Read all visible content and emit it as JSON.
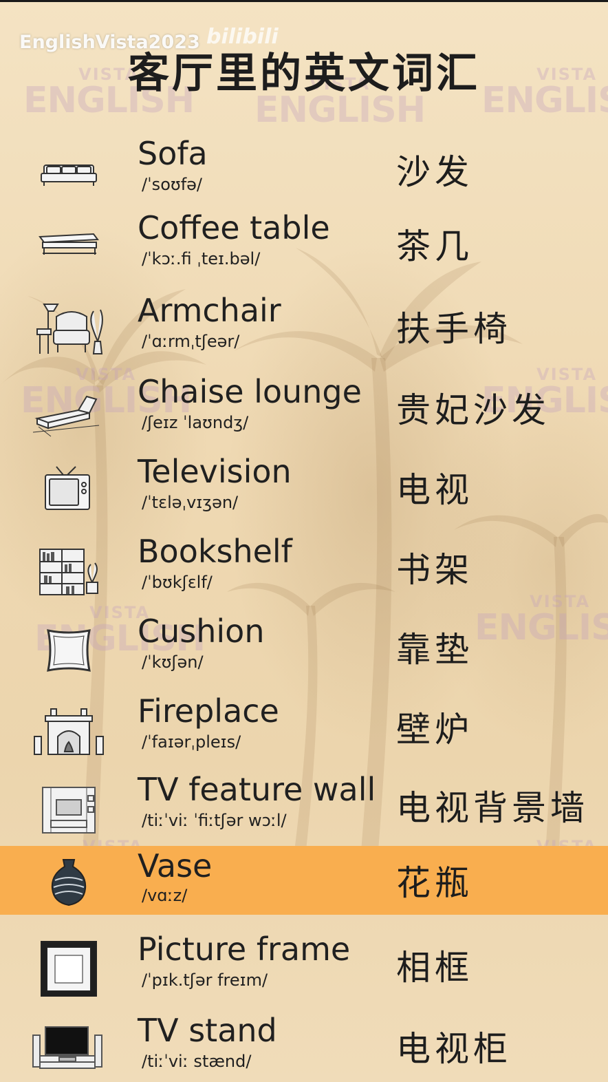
{
  "header": {
    "channel": "EnglishVista2023",
    "platform_logo": "bilibili",
    "title": "客厅里的英文词汇"
  },
  "watermark": {
    "small": "VISTA",
    "big": "ENGLISH"
  },
  "colors": {
    "highlight": "#f9ae4f",
    "background": "#f1dfbd",
    "text": "#1d1d1d"
  },
  "highlighted_index": 9,
  "vocab": [
    {
      "icon": "sofa-icon",
      "word": "Sofa",
      "ipa": "/ˈsoʊfə/",
      "zh": "沙发"
    },
    {
      "icon": "coffee-table-icon",
      "word": "Coffee table",
      "ipa": "/ˈkɔː.fi ˌteɪ.bəl/",
      "zh": "茶几"
    },
    {
      "icon": "armchair-icon",
      "word": "Armchair",
      "ipa": "/ˈɑːrmˌtʃeər/",
      "zh": "扶手椅"
    },
    {
      "icon": "chaise-lounge-icon",
      "word": "Chaise lounge",
      "ipa": "/ʃeɪz ˈlaʊndʒ/",
      "zh": "贵妃沙发"
    },
    {
      "icon": "television-icon",
      "word": "Television",
      "ipa": "/ˈtɛləˌvɪʒən/",
      "zh": "电视"
    },
    {
      "icon": "bookshelf-icon",
      "word": "Bookshelf",
      "ipa": "/ˈbʊkʃɛlf/",
      "zh": "书架"
    },
    {
      "icon": "cushion-icon",
      "word": "Cushion",
      "ipa": "/ˈkʊʃən/",
      "zh": "靠垫"
    },
    {
      "icon": "fireplace-icon",
      "word": "Fireplace",
      "ipa": "/ˈfaɪərˌpleɪs/",
      "zh": "壁炉"
    },
    {
      "icon": "tv-feature-wall-icon",
      "word": "TV feature wall",
      "ipa": "/tiːˈviː ˈfiːtʃər wɔːl/",
      "zh": "电视背景墙"
    },
    {
      "icon": "vase-icon",
      "word": "Vase",
      "ipa": "/vɑːz/",
      "zh": "花瓶"
    },
    {
      "icon": "picture-frame-icon",
      "word": "Picture frame",
      "ipa": "/ˈpɪk.tʃər freɪm/",
      "zh": "相框"
    },
    {
      "icon": "tv-stand-icon",
      "word": "TV stand",
      "ipa": "/tiːˈviː stænd/",
      "zh": "电视柜"
    }
  ]
}
